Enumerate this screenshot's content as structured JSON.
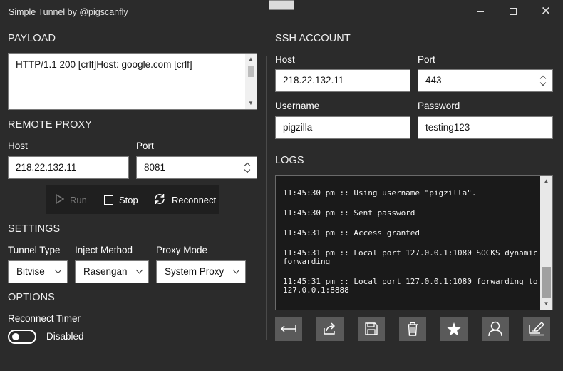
{
  "window": {
    "title": "Simple Tunnel by @pigscanfly",
    "minimize": "",
    "maximize": "",
    "close": "✕"
  },
  "payload": {
    "title": "PAYLOAD",
    "value": "HTTP/1.1 200 [crlf]Host: google.com [crlf]"
  },
  "remote_proxy": {
    "title": "REMOTE PROXY",
    "host_label": "Host",
    "host_value": "218.22.132.11",
    "port_label": "Port",
    "port_value": "8081"
  },
  "actions": {
    "run_label": "Run",
    "stop_label": "Stop",
    "reconnect_label": "Reconnect"
  },
  "settings": {
    "title": "SETTINGS",
    "tunnel_type_label": "Tunnel Type",
    "tunnel_type_value": "Bitvise",
    "inject_method_label": "Inject Method",
    "inject_method_value": "Rasengan",
    "proxy_mode_label": "Proxy Mode",
    "proxy_mode_value": "System Proxy"
  },
  "options": {
    "title": "OPTIONS",
    "reconnect_timer_label": "Reconnect Timer",
    "reconnect_timer_state": "Disabled",
    "reconnect_timer_enabled": false
  },
  "ssh_account": {
    "title": "SSH ACCOUNT",
    "host_label": "Host",
    "host_value": "218.22.132.11",
    "port_label": "Port",
    "port_value": "443",
    "username_label": "Username",
    "username_value": "pigzilla",
    "password_label": "Password",
    "password_value": "testing123"
  },
  "logs": {
    "title": "LOGS",
    "lines": [
      "11:45:30 pm :: Using username \"pigzilla\".",
      "11:45:30 pm :: Sent password",
      "11:45:31 pm :: Access granted",
      "11:45:31 pm :: Local port 127.0.0.1:1080 SOCKS dynamic forwarding",
      "11:45:31 pm :: Local port 127.0.0.1:1080 forwarding to 127.0.0.1:8888"
    ]
  },
  "toolbar_icons": [
    "arrow-left-right-icon",
    "share-icon",
    "save-icon",
    "trash-icon",
    "star-icon",
    "user-icon",
    "edit-icon"
  ],
  "colors": {
    "background": "#2b2b2b",
    "button_bg": "#5a5a5a",
    "logs_bg": "#1a1a1a",
    "disabled_text": "#7a7a7a"
  }
}
